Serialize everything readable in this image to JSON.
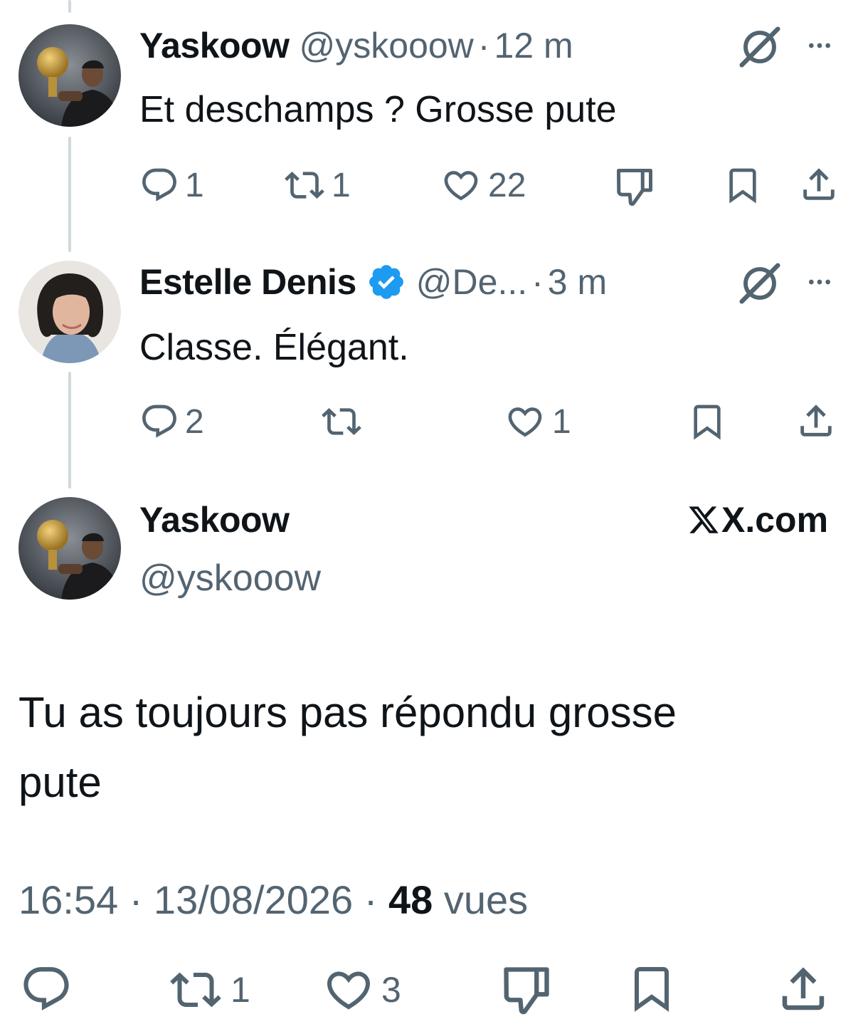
{
  "tweets": [
    {
      "name": "Yaskoow",
      "handle": "@yskooow",
      "sep": "·",
      "time": "12 m",
      "text": "Et deschamps ? Grosse pute",
      "replies": "1",
      "reposts": "1",
      "likes": "22"
    },
    {
      "name": "Estelle Denis",
      "handle": "@De...",
      "sep": "·",
      "time": "3 m",
      "text": "Classe. Élégant.",
      "replies": "2",
      "reposts": "",
      "likes": "1"
    }
  ],
  "main": {
    "name": "Yaskoow",
    "handle": "@yskooow",
    "site": "X.com",
    "text_line1": "Tu as toujours pas répondu grosse",
    "text_line2": "pute",
    "time": "16:54",
    "sep1": "·",
    "date": "13/08/2026",
    "sep2": "·",
    "views_count": "48",
    "views_label": "vues",
    "reposts": "1",
    "likes": "3"
  },
  "colors": {
    "text": "#0f1419",
    "secondary": "#536471",
    "verified": "#1d9bf0",
    "line": "#cfd9de"
  },
  "icons": [
    "reply-icon",
    "repost-icon",
    "like-icon",
    "dislike-icon",
    "bookmark-icon",
    "share-icon",
    "grok-icon",
    "more-icon",
    "verified-badge-icon",
    "x-logo-icon"
  ]
}
